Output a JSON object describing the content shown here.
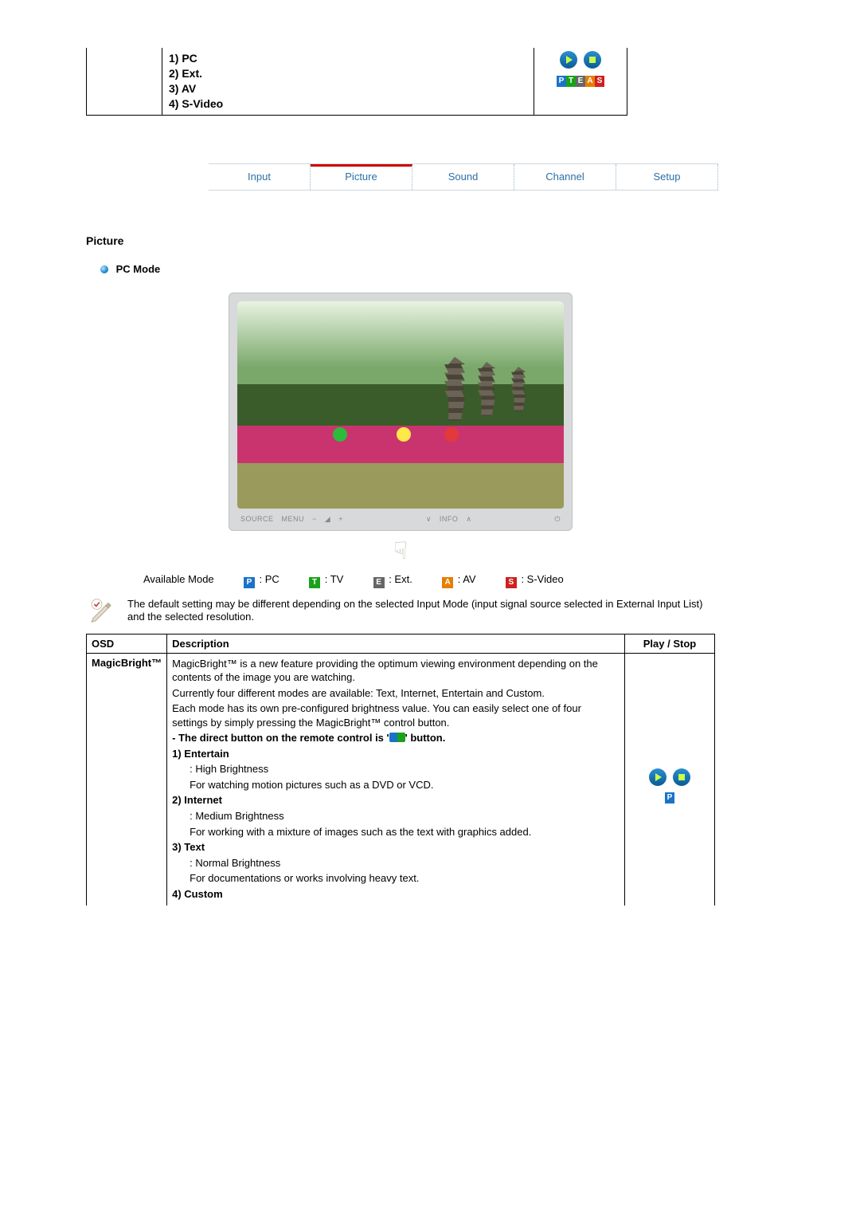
{
  "top_fragment": {
    "items": [
      "1) PC",
      "2) Ext.",
      "3) AV",
      "4) S-Video"
    ],
    "badges": [
      "P",
      "T",
      "E",
      "A",
      "S"
    ]
  },
  "tabs": [
    "Input",
    "Picture",
    "Sound",
    "Channel",
    "Setup"
  ],
  "active_tab_index": 1,
  "section_title": "Picture",
  "sub_heading": "PC Mode",
  "monitor": {
    "labels": {
      "source": "SOURCE",
      "menu": "MENU",
      "info": "INFO"
    }
  },
  "available_mode": {
    "label": "Available Mode",
    "modes": [
      {
        "letter": "P",
        "name": ": PC",
        "class": "mb-P"
      },
      {
        "letter": "T",
        "name": ": TV",
        "class": "mb-T"
      },
      {
        "letter": "E",
        "name": ": Ext.",
        "class": "mb-E"
      },
      {
        "letter": "A",
        "name": ": AV",
        "class": "mb-A"
      },
      {
        "letter": "S",
        "name": ": S-Video",
        "class": "mb-S"
      }
    ]
  },
  "note": "The default setting may be different depending on the selected Input Mode (input signal source selected in External Input List) and the selected resolution.",
  "table": {
    "headers": {
      "osd": "OSD",
      "desc": "Description",
      "play": "Play / Stop"
    },
    "row": {
      "osd": "MagicBright™",
      "intro1": "MagicBright™ is a new feature providing the optimum viewing environment depending on the contents of the image you are watching.",
      "intro2": "Currently four different modes are available: Text, Internet, Entertain and Custom.",
      "intro3": "Each mode has its own pre-configured brightness value. You can easily select one of four settings by simply pressing the MagicBright™ control button.",
      "direct_a": "- The direct button on the remote control is '",
      "direct_b": "' button.",
      "m1_t": "1) Entertain",
      "m1_a": ": High Brightness",
      "m1_b": "For watching motion pictures such as a DVD or VCD.",
      "m2_t": "2) Internet",
      "m2_a": ": Medium Brightness",
      "m2_b": "For working with a mixture of images such as the text with graphics added.",
      "m3_t": "3) Text",
      "m3_a": ": Normal Brightness",
      "m3_b": "For documentations or works involving heavy text.",
      "m4_t": "4) Custom"
    }
  }
}
